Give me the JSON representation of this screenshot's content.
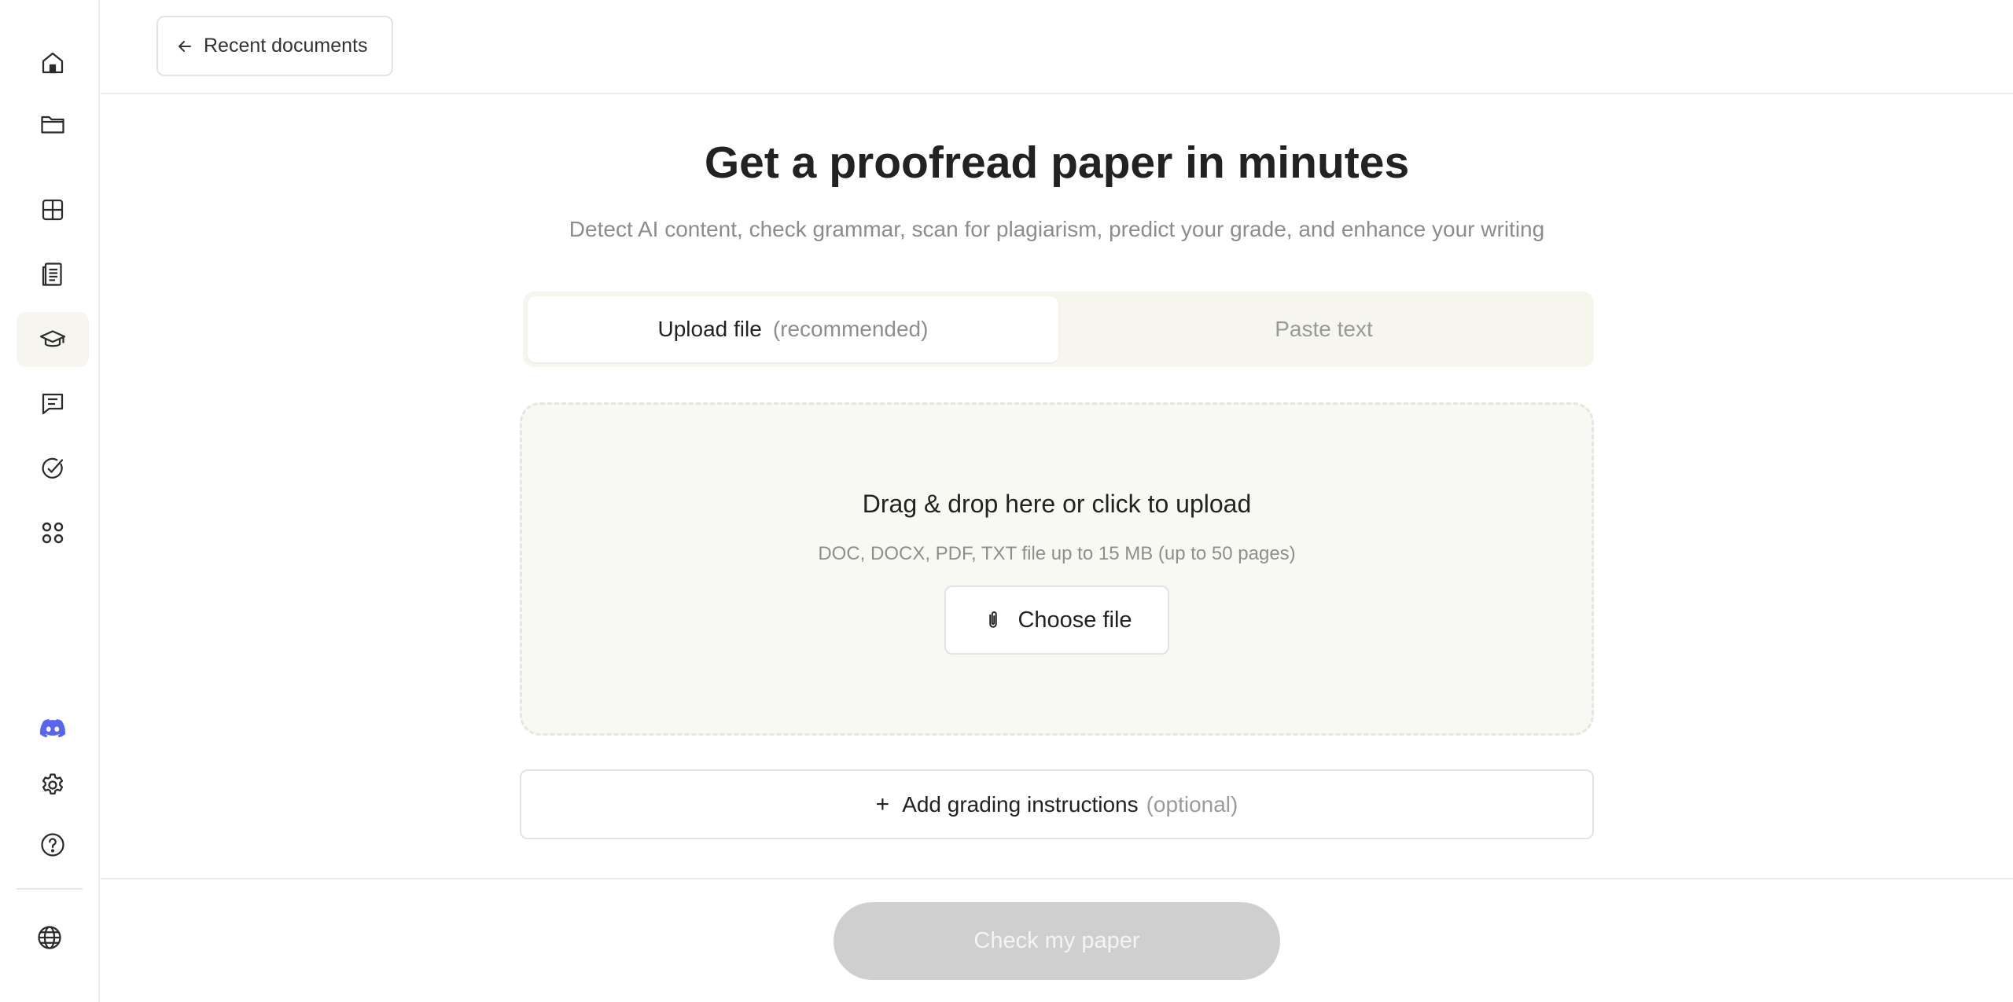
{
  "topbar": {
    "back_label": "Recent documents"
  },
  "main": {
    "title": "Get a proofread paper in minutes",
    "subtitle": "Detect AI content, check grammar, scan for plagiarism, predict your grade, and enhance your writing"
  },
  "tabs": [
    {
      "label": "Upload file",
      "note": "(recommended)",
      "active": true
    },
    {
      "label": "Paste text",
      "active": false
    }
  ],
  "dropzone": {
    "title": "Drag & drop here or click to upload",
    "subtitle": "DOC, DOCX, PDF, TXT file up to 15 MB (up to 50 pages)",
    "button_label": "Choose file"
  },
  "grading": {
    "label": "Add grading instructions",
    "note": "(optional)"
  },
  "footer": {
    "submit_label": "Check my paper"
  },
  "sidebar": {
    "icons": [
      "home-icon",
      "folder-icon",
      "grid-icon",
      "notebook-icon",
      "graduation-cap-icon",
      "chat-icon",
      "check-circle-icon",
      "apps-icon",
      "discord-icon",
      "gear-icon",
      "help-icon",
      "globe-icon"
    ],
    "active": "graduation-cap-icon"
  },
  "colors": {
    "accent_bg": "#f6f6ef",
    "discord": "#5865F2",
    "disabled_button": "#cfcfcf"
  }
}
